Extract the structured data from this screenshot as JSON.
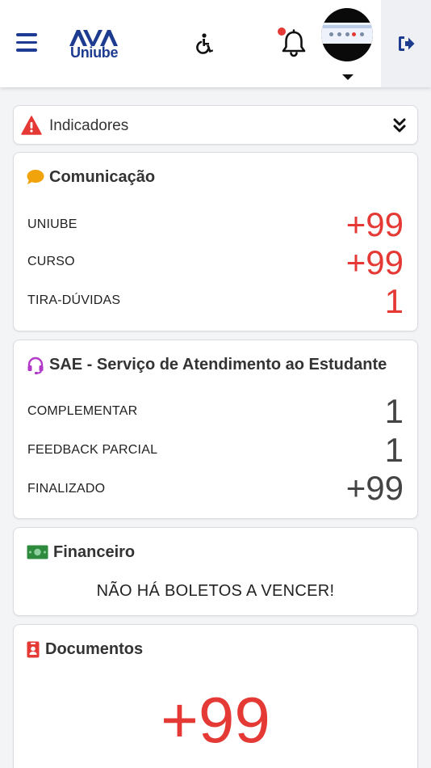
{
  "header": {
    "logo_top": "AVA",
    "logo_bottom": "Uniube"
  },
  "indicators": {
    "label": "Indicadores"
  },
  "comunicacao": {
    "title": "Comunicação",
    "rows": [
      {
        "label": "UNIUBE",
        "value": "+99"
      },
      {
        "label": "CURSO",
        "value": "+99"
      },
      {
        "label": "TIRA-DÚVIDAS",
        "value": "1"
      }
    ]
  },
  "sae": {
    "title": "SAE - Serviço de Atendimento ao Estudante",
    "rows": [
      {
        "label": "COMPLEMENTAR",
        "value": "1"
      },
      {
        "label": "FEEDBACK PARCIAL",
        "value": "1"
      },
      {
        "label": "FINALIZADO",
        "value": "+99"
      }
    ]
  },
  "financeiro": {
    "title": "Financeiro",
    "message": "NÃO HÁ BOLETOS A VENCER!"
  },
  "documentos": {
    "title": "Documentos",
    "value": "+99"
  },
  "icons": {
    "menu": "hamburger-menu-icon",
    "accessibility": "wheelchair-accessibility-icon",
    "notifications": "bell-icon",
    "logout": "sign-out-icon",
    "warning": "warning-triangle-icon",
    "expand": "double-chevron-down-icon",
    "comunicacao": "comment-icon",
    "sae": "headset-icon",
    "financeiro": "money-bill-icon",
    "documentos": "id-badge-icon"
  },
  "colors": {
    "brand_blue": "#1d3b8f",
    "accent_red": "#e53935",
    "comment_orange": "#f0a30a",
    "headset_purple": "#b23ac9",
    "money_green": "#2e8b3e"
  }
}
